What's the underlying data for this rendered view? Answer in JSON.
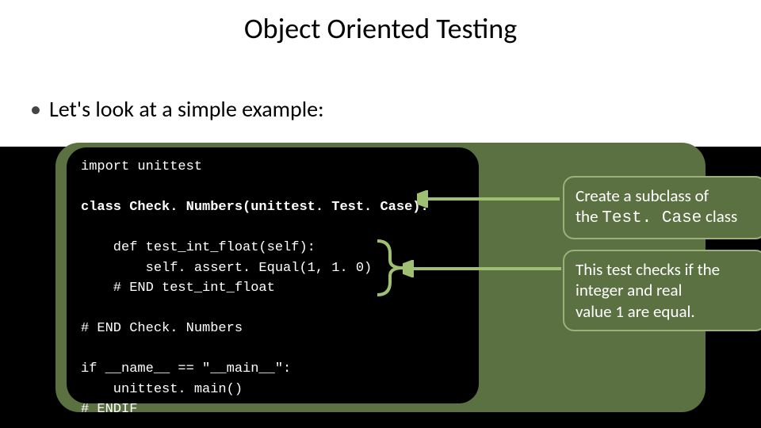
{
  "title": "Object Oriented Testing",
  "bullet": "Let's look at a simple example:",
  "code": {
    "l1": "import unittest",
    "l2": "class Check. Numbers(unittest. Test. Case):",
    "l3": "    def test_int_float(self):",
    "l4": "        self. assert. Equal(1, 1. 0)",
    "l5": "    # END test_int_float",
    "l6": "# END Check. Numbers",
    "l7": "if __name__ == \"__main__\":",
    "l8": "    unittest. main()",
    "l9": "# ENDIF"
  },
  "callouts": {
    "c1a": "Create a subclass of",
    "c1b_pre": "the ",
    "c1b_mono": "Test. Case",
    "c1b_post": " class",
    "c2a": "This test checks if the",
    "c2b": "integer and real",
    "c2c": "value 1 are equal."
  }
}
